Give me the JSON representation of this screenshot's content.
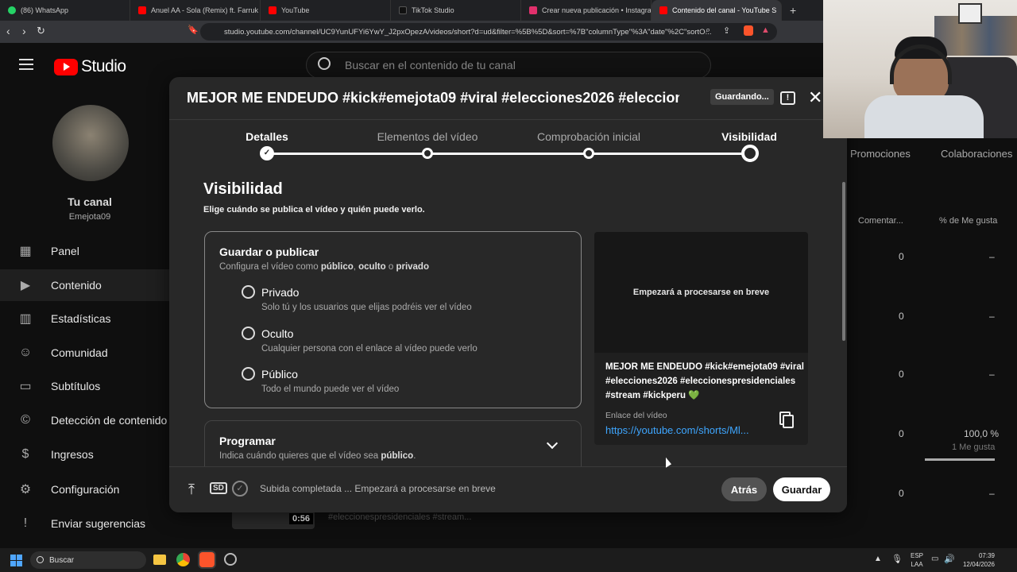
{
  "browser": {
    "tabs": [
      {
        "label": "(86) WhatsApp",
        "color": "#25d366"
      },
      {
        "label": "Anuel AA - Sola (Remix) ft. Farruk",
        "color": "#ff0000"
      },
      {
        "label": "YouTube",
        "color": "#ff0000"
      },
      {
        "label": "TikTok Studio",
        "color": "#111111"
      },
      {
        "label": "Crear nueva publicación • Instagram",
        "color": "#e1306c"
      },
      {
        "label": "Contenido del canal - YouTube S",
        "color": "#ff0000"
      }
    ],
    "url": "studio.youtube.com/channel/UC9YunUFYi6YwY_J2pxOpezA/videos/short?d=ud&filter=%5B%5D&sort=%7B\"columnType\"%3A\"date\"%2C\"sortO..."
  },
  "studio": {
    "logo": "Studio",
    "search_placeholder": "Buscar en el contenido de tu canal",
    "channel_title": "Tu canal",
    "channel_handle": "Emejota09",
    "nav": [
      {
        "label": "Panel",
        "icon": "dashboard-icon"
      },
      {
        "label": "Contenido",
        "icon": "content-icon"
      },
      {
        "label": "Estadísticas",
        "icon": "analytics-icon"
      },
      {
        "label": "Comunidad",
        "icon": "community-icon"
      },
      {
        "label": "Subtítulos",
        "icon": "subtitles-icon"
      },
      {
        "label": "Detección de contenido",
        "icon": "copyright-icon"
      },
      {
        "label": "Ingresos",
        "icon": "earn-icon"
      },
      {
        "label": "Configuración",
        "icon": "settings-icon"
      },
      {
        "label": "Enviar sugerencias",
        "icon": "feedback-icon"
      }
    ],
    "background": {
      "tabs": [
        "Promociones",
        "Colaboraciones"
      ],
      "col_comments": "Comentar...",
      "col_likes": "% de Me gusta",
      "rows": [
        {
          "comments": "0",
          "likes": "–",
          "likes_sub": ""
        },
        {
          "comments": "0",
          "likes": "–",
          "likes_sub": ""
        },
        {
          "comments": "0",
          "likes": "–",
          "likes_sub": ""
        },
        {
          "comments": "0",
          "likes": "100,0 %",
          "likes_sub": "1 Me gusta"
        },
        {
          "comments": "0",
          "likes": "–",
          "likes_sub": ""
        }
      ],
      "duration": "0:56",
      "snippet": "#eleccionespresidenciales #stream..."
    }
  },
  "dialog": {
    "title": "MEJOR ME ENDEUDO #kick#emejota09 #viral #elecciones2026 #eleccion...",
    "saving": "Guardando...",
    "steps": [
      "Detalles",
      "Elementos del vídeo",
      "Comprobación inicial",
      "Visibilidad"
    ],
    "heading": "Visibilidad",
    "subheading": "Elige cuándo se publica el vídeo y quién puede verlo.",
    "save_card": {
      "title": "Guardar o publicar",
      "desc_prefix": "Configura el vídeo como ",
      "opt_public": "público",
      "sep1": ", ",
      "opt_hidden": "oculto",
      "sep2": " o ",
      "opt_private": "privado"
    },
    "options": [
      {
        "label": "Privado",
        "desc": "Solo tú y los usuarios que elijas podréis ver el vídeo"
      },
      {
        "label": "Oculto",
        "desc": "Cualquier persona con el enlace al vídeo puede verlo"
      },
      {
        "label": "Público",
        "desc": "Todo el mundo puede ver el vídeo"
      }
    ],
    "schedule": {
      "title": "Programar",
      "desc_prefix": "Indica cuándo quieres que el vídeo sea ",
      "desc_bold": "público",
      "desc_suffix": "."
    },
    "preview": {
      "processing": "Empezará a procesarse en breve",
      "video_title": "MEJOR ME ENDEUDO #kick#emejota09 #viral #elecciones2026 #eleccionespresidenciales #stream #kickperu 💚",
      "link_label": "Enlace del vídeo",
      "link": "https://youtube.com/shorts/Ml..."
    },
    "footer": {
      "badge": "SD",
      "status": "Subida completada ... Empezará a procesarse en breve",
      "back": "Atrás",
      "save": "Guardar"
    }
  },
  "taskbar": {
    "search": "Buscar",
    "lang1": "ESP",
    "lang2": "LAA",
    "time": "07:39",
    "date": "12/04/2026"
  },
  "colors": {
    "accent": "#3ea6ff",
    "youtube_red": "#ff0000",
    "modal_bg": "#282828"
  }
}
